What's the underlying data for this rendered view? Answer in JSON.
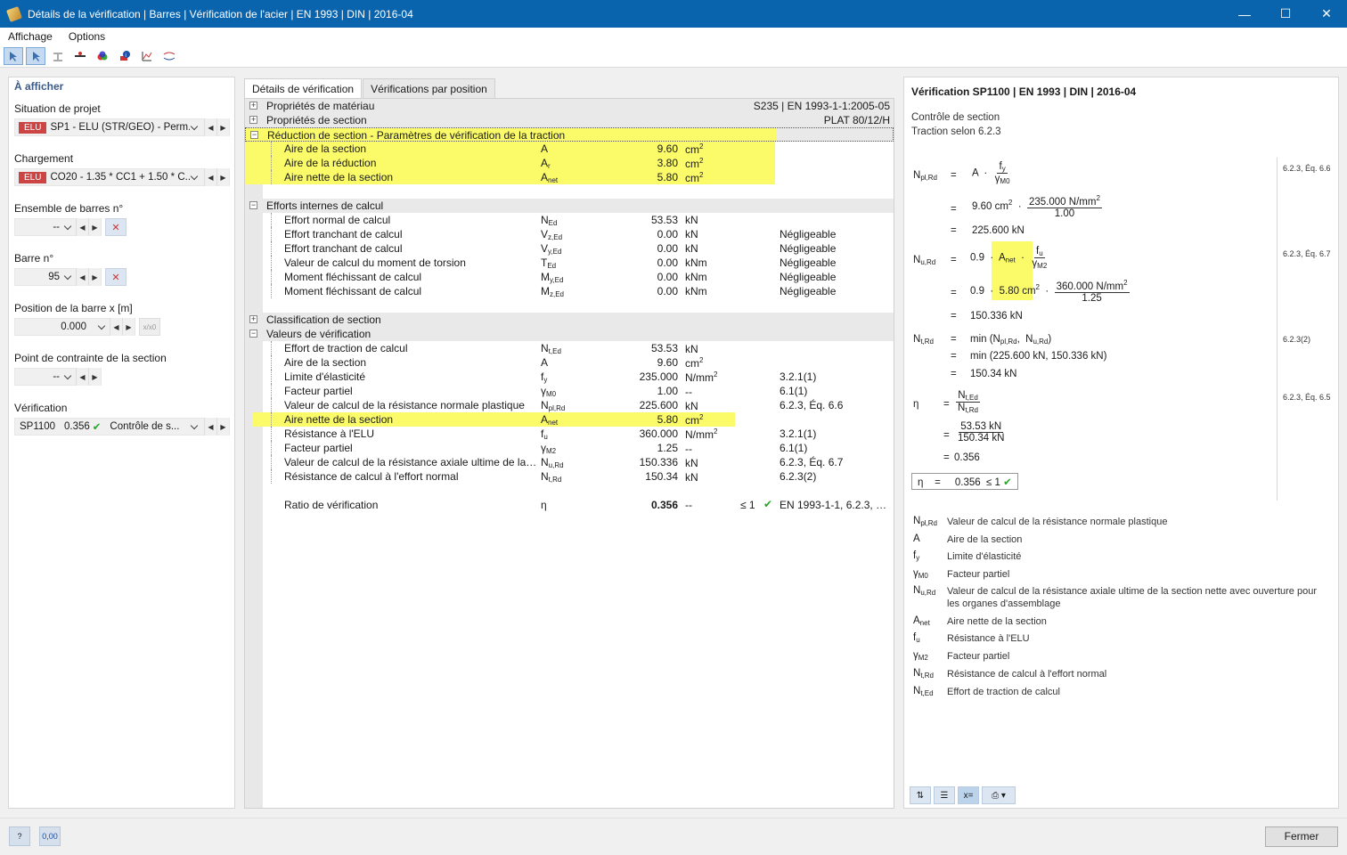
{
  "window": {
    "title": "Détails de la vérification | Barres | Vérification de l'acier | EN 1993 | DIN | 2016-04",
    "minimize": "—",
    "maximize": "☐",
    "close": "✕"
  },
  "menu": {
    "items": [
      "Affichage",
      "Options"
    ]
  },
  "left": {
    "title": "À afficher",
    "situation_label": "Situation de projet",
    "situation_badge": "ELU",
    "situation_value": "SP1 - ELU (STR/GEO) - Perm...",
    "chargement_label": "Chargement",
    "chargement_badge": "ELU",
    "chargement_value": "CO20 - 1.35 * CC1 + 1.50 * C...",
    "ensemble_label": "Ensemble de barres n°",
    "ensemble_value": "--",
    "barre_label": "Barre n°",
    "barre_value": "95",
    "position_label": "Position de la barre x [m]",
    "position_value": "0.000",
    "position_extra": "x/x0",
    "point_label": "Point de contrainte de la section",
    "point_value": "--",
    "verif_label": "Vérification",
    "verif_id": "SP1100",
    "verif_ratio": "0.356",
    "verif_text": "Contrôle de s..."
  },
  "tabs": [
    "Détails de vérification",
    "Vérifications par position"
  ],
  "grid": {
    "g_materiau": "Propriétés de matériau",
    "g_materiau_r": "S235 | EN 1993-1-1:2005-05",
    "g_section": "Propriétés de section",
    "g_section_r": "PLAT 80/12/H",
    "g_reduction": "Réduction de section - Paramètres de vérification de la traction",
    "red": [
      {
        "name": "Aire de la section",
        "sym": "A",
        "sub": "",
        "val": "9.60",
        "unit": "cm",
        "sup": "2"
      },
      {
        "name": "Aire de la réduction",
        "sym": "A",
        "sub": "r",
        "val": "3.80",
        "unit": "cm",
        "sup": "2"
      },
      {
        "name": "Aire nette de la section",
        "sym": "A",
        "sub": "net",
        "val": "5.80",
        "unit": "cm",
        "sup": "2"
      }
    ],
    "g_efforts": "Efforts internes de calcul",
    "eff": [
      {
        "name": "Effort normal de calcul",
        "sym": "N",
        "sub": "Ed",
        "val": "53.53",
        "unit": "kN",
        "ref": ""
      },
      {
        "name": "Effort tranchant de calcul",
        "sym": "V",
        "sub": "z,Ed",
        "val": "0.00",
        "unit": "kN",
        "ref": "Négligeable"
      },
      {
        "name": "Effort tranchant de calcul",
        "sym": "V",
        "sub": "y,Ed",
        "val": "0.00",
        "unit": "kN",
        "ref": "Négligeable"
      },
      {
        "name": "Valeur de calcul du moment de torsion",
        "sym": "T",
        "sub": "Ed",
        "val": "0.00",
        "unit": "kNm",
        "ref": "Négligeable"
      },
      {
        "name": "Moment fléchissant de calcul",
        "sym": "M",
        "sub": "y,Ed",
        "val": "0.00",
        "unit": "kNm",
        "ref": "Négligeable"
      },
      {
        "name": "Moment fléchissant de calcul",
        "sym": "M",
        "sub": "z,Ed",
        "val": "0.00",
        "unit": "kNm",
        "ref": "Négligeable"
      }
    ],
    "g_classif": "Classification de section",
    "g_valeurs": "Valeurs de vérification",
    "vv": [
      {
        "name": "Effort de traction de calcul",
        "sym": "N",
        "sub": "t,Ed",
        "val": "53.53",
        "unit": "kN",
        "sup": "",
        "ref": ""
      },
      {
        "name": "Aire de la section",
        "sym": "A",
        "sub": "",
        "val": "9.60",
        "unit": "cm",
        "sup": "2",
        "ref": ""
      },
      {
        "name": "Limite d'élasticité",
        "sym": "f",
        "sub": "y",
        "val": "235.000",
        "unit": "N/mm",
        "sup": "2",
        "ref": "3.2.1(1)"
      },
      {
        "name": "Facteur partiel",
        "sym": "γ",
        "sub": "M0",
        "val": "1.00",
        "unit": "--",
        "sup": "",
        "ref": "6.1(1)"
      },
      {
        "name": "Valeur de calcul de la résistance normale plastique",
        "sym": "N",
        "sub": "pl,Rd",
        "val": "225.600",
        "unit": "kN",
        "sup": "",
        "ref": "6.2.3, Éq. 6.6"
      },
      {
        "name": "Aire nette de la section",
        "sym": "A",
        "sub": "net",
        "val": "5.80",
        "unit": "cm",
        "sup": "2",
        "ref": ""
      },
      {
        "name": "Résistance à l'ELU",
        "sym": "f",
        "sub": "u",
        "val": "360.000",
        "unit": "N/mm",
        "sup": "2",
        "ref": "3.2.1(1)"
      },
      {
        "name": "Facteur partiel",
        "sym": "γ",
        "sub": "M2",
        "val": "1.25",
        "unit": "--",
        "sup": "",
        "ref": "6.1(1)"
      },
      {
        "name": "Valeur de calcul de la résistance axiale ultime de la se...",
        "sym": "N",
        "sub": "u,Rd",
        "val": "150.336",
        "unit": "kN",
        "sup": "",
        "ref": "6.2.3, Éq. 6.7"
      },
      {
        "name": "Résistance de calcul à l'effort normal",
        "sym": "N",
        "sub": "t,Rd",
        "val": "150.34",
        "unit": "kN",
        "sup": "",
        "ref": "6.2.3(2)"
      }
    ],
    "ratio": {
      "name": "Ratio de vérification",
      "sym": "η",
      "val": "0.356",
      "unit": "--",
      "cond": "≤ 1",
      "ref": "EN 1993-1-1, 6.2.3, Éq. ..."
    }
  },
  "right": {
    "title": "Vérification SP1100 | EN 1993 | DIN | 2016-04",
    "sub1": "Contrôle de section",
    "sub2": "Traction selon 6.2.3",
    "ref1": "6.2.3, Éq. 6.6",
    "ref2": "6.2.3, Éq. 6.7",
    "ref3": "6.2.3(2)",
    "ref4": "6.2.3, Éq. 6.5",
    "f1_a": "9.60 cm",
    "f1_num": "235.000 N/mm",
    "f1_den": "1.00",
    "f1_res": "225.600 kN",
    "f2_coef": "0.9",
    "f2_a": "5.80 cm",
    "f2_num": "360.000 N/mm",
    "f2_den": "1.25",
    "f2_res": "150.336 kN",
    "f3_a": "min (225.600 kN,  150.336 kN)",
    "f3_res": "150.34 kN",
    "f4_num": "53.53 kN",
    "f4_den": "150.34 kN",
    "f4_res": "0.356",
    "final": "0.356",
    "final_cond": "≤ 1",
    "legend": [
      {
        "sym": "N",
        "sub": "pl,Rd",
        "txt": "Valeur de calcul de la résistance normale plastique"
      },
      {
        "sym": "A",
        "sub": "",
        "txt": "Aire de la section"
      },
      {
        "sym": "f",
        "sub": "y",
        "txt": "Limite d'élasticité"
      },
      {
        "sym": "γ",
        "sub": "M0",
        "txt": "Facteur partiel"
      },
      {
        "sym": "N",
        "sub": "u,Rd",
        "txt": "Valeur de calcul de la résistance axiale ultime de la section nette avec ouverture pour les organes d'assemblage"
      },
      {
        "sym": "A",
        "sub": "net",
        "txt": "Aire nette de la section"
      },
      {
        "sym": "f",
        "sub": "u",
        "txt": "Résistance à l'ELU"
      },
      {
        "sym": "γ",
        "sub": "M2",
        "txt": "Facteur partiel"
      },
      {
        "sym": "N",
        "sub": "t,Rd",
        "txt": "Résistance de calcul à l'effort normal"
      },
      {
        "sym": "N",
        "sub": "t,Ed",
        "txt": "Effort de traction de calcul"
      }
    ]
  },
  "footer": {
    "close": "Fermer",
    "units": "0,00"
  }
}
